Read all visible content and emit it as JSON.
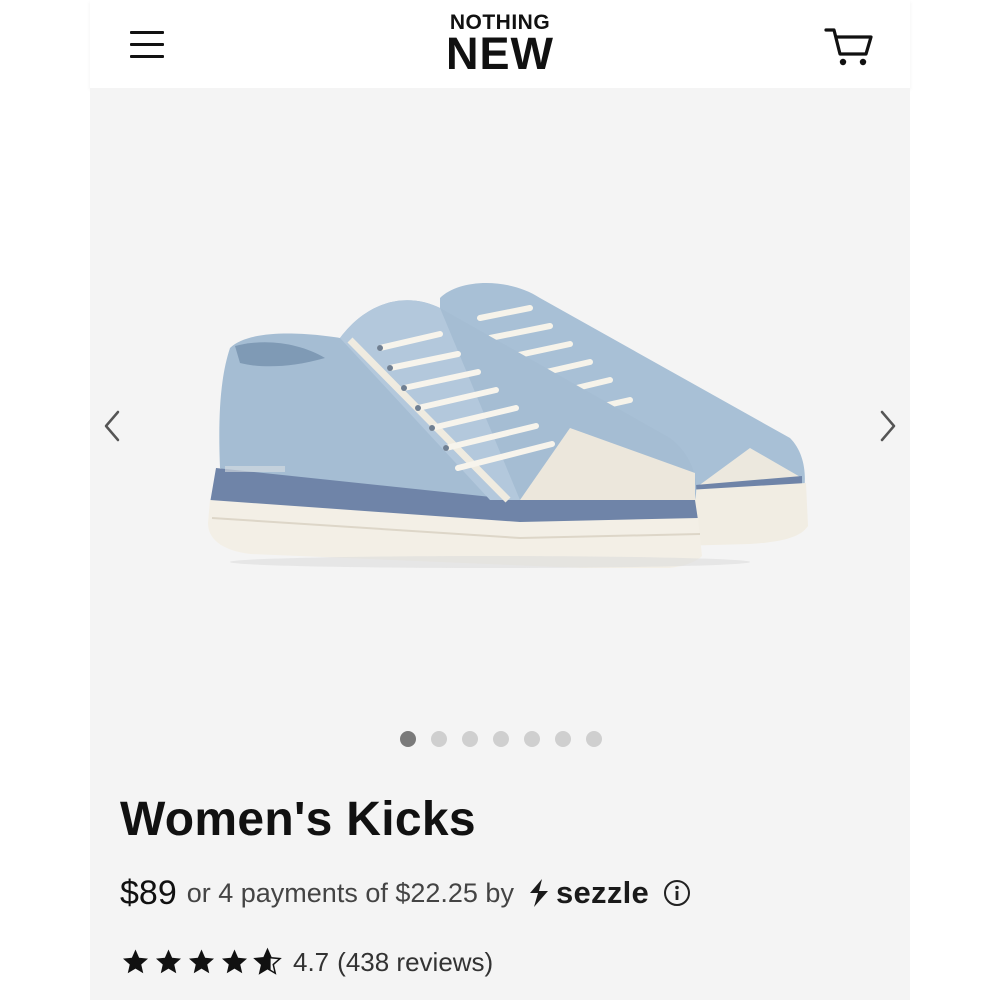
{
  "header": {
    "menu_icon": "hamburger-menu-icon",
    "logo_line1": "NOTHING",
    "logo_line2": "NEW",
    "cart_icon": "shopping-cart-icon"
  },
  "gallery": {
    "image_alt": "Light blue canvas low-top sneakers",
    "prev_icon": "chevron-left-icon",
    "next_icon": "chevron-right-icon",
    "slide_count": 7,
    "active_slide": 1
  },
  "product": {
    "title": "Women's Kicks",
    "price": "$89",
    "installment_text": "or 4 payments of $22.25 by",
    "sezzle_label": "sezzle",
    "info_icon": "info-icon",
    "rating_value": 4.7,
    "rating_label": "4.7",
    "reviews_label": "(438 reviews)"
  },
  "colors": {
    "page_bg": "#f4f4f4",
    "header_bg": "#ffffff",
    "text": "#111111",
    "dot_active": "#7a7a7a",
    "dot_inactive": "#cfcfcf"
  }
}
